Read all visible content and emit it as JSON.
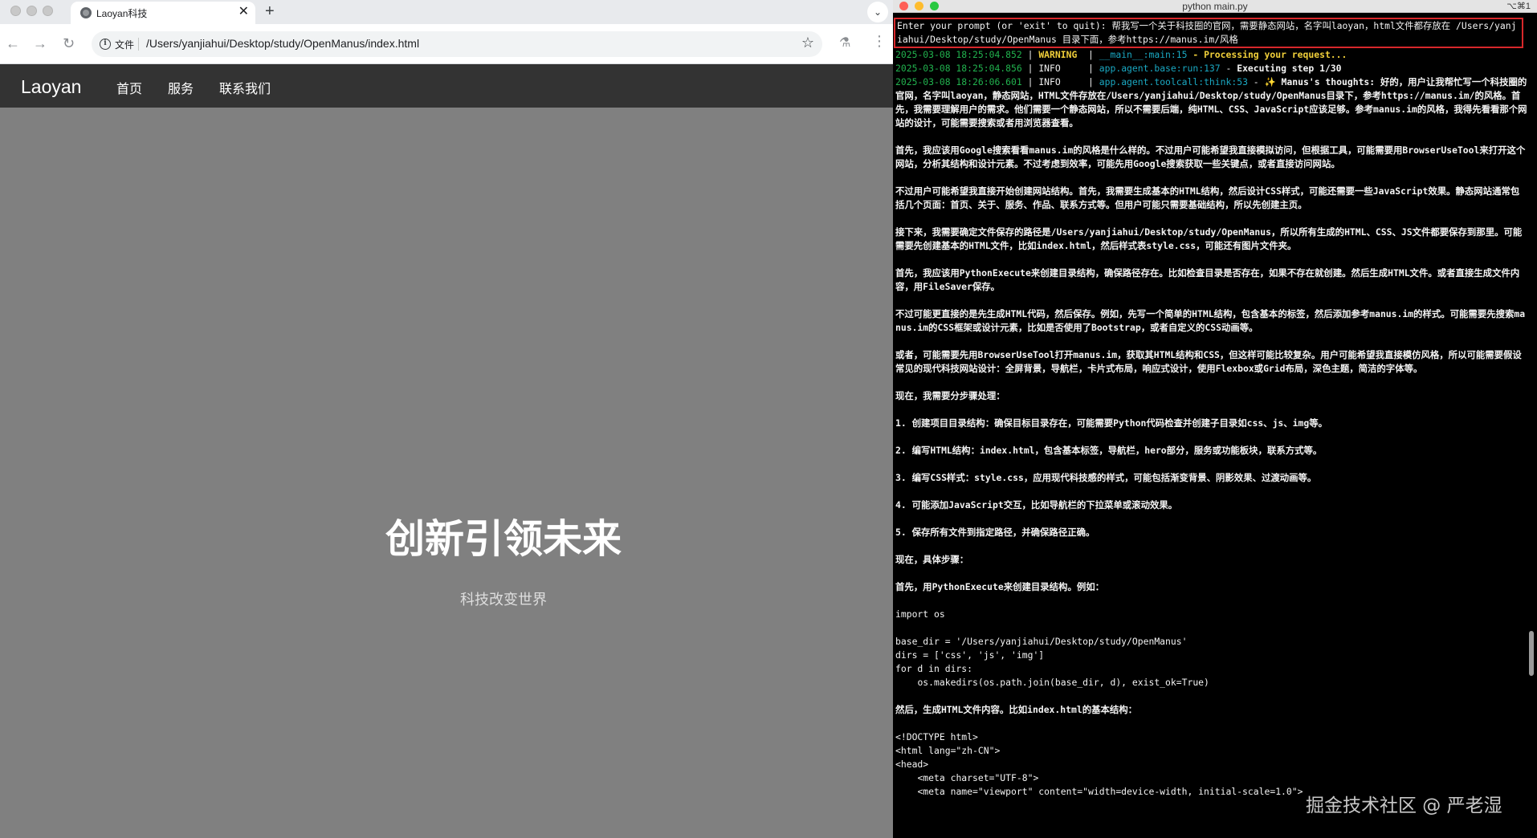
{
  "browser": {
    "tab_title": "Laoyan科技",
    "tab_close": "✕",
    "new_tab": "+",
    "tab_menu": "⌄",
    "scheme_chip": "文件",
    "url": "/Users/yanjiahui/Desktop/study/OpenManus/index.html",
    "icons": {
      "back": "←",
      "forward": "→",
      "reload": "↻",
      "info": "i",
      "bookmark": "☆",
      "labs": "⚗",
      "menu": "⋮"
    }
  },
  "site": {
    "logo": "Laoyan",
    "nav": [
      "首页",
      "服务",
      "联系我们"
    ],
    "hero_title": "创新引领未来",
    "hero_subtitle": "科技改变世界"
  },
  "terminal": {
    "title": "python main.py",
    "shortcut": "⌥⌘1",
    "prompt": "Enter your prompt (or 'exit' to quit): 帮我写一个关于科技圈的官网，需要静态网站，名字叫laoyan，html文件都存放在 /Users/yanjiahui/Desktop/study/OpenManus 目录下面，参考https://manus.im/风格",
    "logs": [
      {
        "ts": "2025-03-08 18:25:04.852",
        "sep": " | ",
        "level": "WARNING ",
        "mid": " | ",
        "source": "__main__:main:15",
        "dash": " - ",
        "msg": "Processing your request..."
      },
      {
        "ts": "2025-03-08 18:25:04.856",
        "sep": " | ",
        "level": "INFO    ",
        "mid": " | ",
        "source": "app.agent.base:run:137",
        "dash": " - ",
        "msg": "Executing step 1/30"
      },
      {
        "ts": "2025-03-08 18:26:06.601",
        "sep": " | ",
        "level": "INFO    ",
        "mid": " | ",
        "source": "app.agent.toolcall:think:53",
        "dash": " - ",
        "msg": "✨ Manus's thoughts: 好的，用户让我帮忙写一个科技圈的官网，名字叫laoyan，静态网站，HTML文件存放在/Users/yanjiahui/Desktop/study/OpenManus目录下，参考https://manus.im/的风格。首先，我需要理解用户的需求。他们需要一个静态网站，所以不需要后端，纯HTML、CSS、JavaScript应该足够。参考manus.im的风格，我得先看看那个网站的设计，可能需要搜索或者用浏览器查看。"
      }
    ],
    "paragraphs": [
      "首先，我应该用Google搜索看看manus.im的风格是什么样的。不过用户可能希望我直接模拟访问，但根据工具，可能需要用BrowserUseTool来打开这个网站，分析其结构和设计元素。不过考虑到效率，可能先用Google搜索获取一些关键点，或者直接访问网站。",
      "不过用户可能希望我直接开始创建网站结构。首先，我需要生成基本的HTML结构，然后设计CSS样式，可能还需要一些JavaScript效果。静态网站通常包括几个页面：首页、关于、服务、作品、联系方式等。但用户可能只需要基础结构，所以先创建主页。",
      "接下来，我需要确定文件保存的路径是/Users/yanjiahui/Desktop/study/OpenManus，所以所有生成的HTML、CSS、JS文件都要保存到那里。可能需要先创建基本的HTML文件，比如index.html，然后样式表style.css，可能还有图片文件夹。",
      "首先，我应该用PythonExecute来创建目录结构，确保路径存在。比如检查目录是否存在，如果不存在就创建。然后生成HTML文件。或者直接生成文件内容，用FileSaver保存。",
      "不过可能更直接的是先生成HTML代码，然后保存。例如，先写一个简单的HTML结构，包含基本的标签，然后添加参考manus.im的样式。可能需要先搜索manus.im的CSS框架或设计元素，比如是否使用了Bootstrap，或者自定义的CSS动画等。",
      "或者，可能需要先用BrowserUseTool打开manus.im，获取其HTML结构和CSS，但这样可能比较复杂。用户可能希望我直接模仿风格，所以可能需要假设常见的现代科技网站设计：全屏背景，导航栏，卡片式布局，响应式设计，使用Flexbox或Grid布局，深色主题，简洁的字体等。",
      "现在，我需要分步骤处理：",
      "1. 创建项目目录结构：确保目标目录存在，可能需要Python代码检查并创建子目录如css、js、img等。",
      "2. 编写HTML结构：index.html，包含基本标签，导航栏，hero部分，服务或功能板块，联系方式等。",
      "3. 编写CSS样式：style.css，应用现代科技感的样式，可能包括渐变背景、阴影效果、过渡动画等。",
      "4. 可能添加JavaScript交互，比如导航栏的下拉菜单或滚动效果。",
      "5. 保存所有文件到指定路径，并确保路径正确。",
      "现在，具体步骤：",
      "首先，用PythonExecute来创建目录结构。例如："
    ],
    "code_import": "import os",
    "code_block": [
      "base_dir = '/Users/yanjiahui/Desktop/study/OpenManus'",
      "dirs = ['css', 'js', 'img']",
      "for d in dirs:",
      "    os.makedirs(os.path.join(base_dir, d), exist_ok=True)"
    ],
    "after_code": "然后，生成HTML文件内容。比如index.html的基本结构：",
    "html_code": [
      "<!DOCTYPE html>",
      "<html lang=\"zh-CN\">",
      "<head>",
      "    <meta charset=\"UTF-8\">",
      "    <meta name=\"viewport\" content=\"width=device-width, initial-scale=1.0\">"
    ],
    "watermark": "掘金技术社区 @ 严老湿"
  },
  "colors": {
    "prompt_border": "#d8282b",
    "timestamp": "#21b24e",
    "warning": "#f0cf3a",
    "source": "#1aa8c2",
    "page_background": "#808080",
    "navbar": "#333333"
  }
}
